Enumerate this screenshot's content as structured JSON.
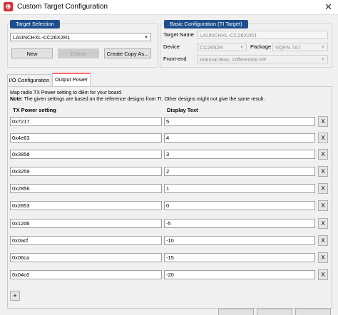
{
  "window": {
    "title": "Custom Target Configuration",
    "icon_text": "⊕"
  },
  "target_selection": {
    "label": "Target Selection",
    "selected": "LAUNCHXL-CC26X2R1",
    "buttons": {
      "new": "New",
      "delete": "Delete",
      "copy": "Create Copy As..."
    }
  },
  "basic_config": {
    "label": "Basic Configuration (TI Target)",
    "target_name_label": "Target Name",
    "target_name_value": "LAUNCHXL-CC26X2R1",
    "device_label": "Device",
    "device_value": "CC2652R",
    "package_label": "Package",
    "package_value": "VQFN 7x7",
    "frontend_label": "Front-end",
    "frontend_value": "Internal Bias, Differential RF"
  },
  "tabs": [
    {
      "label": "I/O Configuration",
      "active": false
    },
    {
      "label": "Output Power",
      "active": true
    }
  ],
  "output_power": {
    "description_line1": "Map radio TX Power setting to dBm for your board.",
    "note_label": "Note:",
    "note_text": " The given settings are based on the reference designs from TI. Other designs might not give the same result.",
    "col_tx": "TX Power setting",
    "col_display": "Display Text",
    "rows": [
      {
        "tx": "0x7217",
        "display": "5"
      },
      {
        "tx": "0x4e63",
        "display": "4"
      },
      {
        "tx": "0x385d",
        "display": "3"
      },
      {
        "tx": "0x3259",
        "display": "2"
      },
      {
        "tx": "0x2856",
        "display": "1"
      },
      {
        "tx": "0x2853",
        "display": "0"
      },
      {
        "tx": "0x12d6",
        "display": "-5"
      },
      {
        "tx": "0x0acf",
        "display": "-10"
      },
      {
        "tx": "0x06ca",
        "display": "-15"
      },
      {
        "tx": "0x04c6",
        "display": "-20"
      }
    ],
    "delete_label": "X",
    "add_label": "+"
  }
}
